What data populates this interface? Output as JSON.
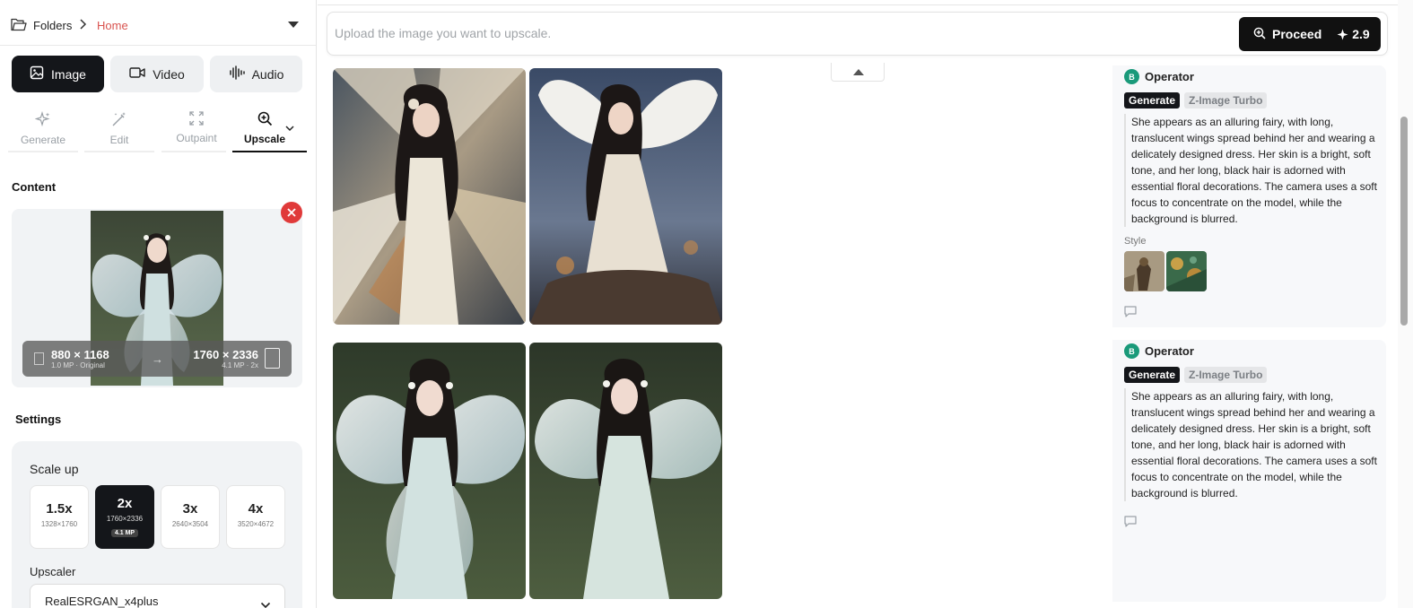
{
  "breadcrumb": {
    "root": "Folders",
    "current": "Home"
  },
  "media_tabs": [
    {
      "label": "Image",
      "icon": "image-icon",
      "active": true
    },
    {
      "label": "Video",
      "icon": "video-icon",
      "active": false
    },
    {
      "label": "Audio",
      "icon": "audio-icon",
      "active": false
    }
  ],
  "tools": [
    {
      "label": "Generate",
      "icon": "sparkle-icon",
      "active": false
    },
    {
      "label": "Edit",
      "icon": "wand-icon",
      "active": false
    },
    {
      "label": "Outpaint",
      "icon": "expand-icon",
      "active": false
    },
    {
      "label": "Upscale",
      "icon": "zoom-in-icon",
      "active": true
    }
  ],
  "content": {
    "title": "Content",
    "original_res": "880 × 1168",
    "original_meta": "1.0 MP · Original",
    "arrow": "→",
    "target_res": "1760 × 2336",
    "target_meta": "4.1 MP · 2x"
  },
  "settings": {
    "title": "Settings",
    "scale_label": "Scale up",
    "scales": [
      {
        "value": "1.5x",
        "dims": "1328×1760",
        "active": false
      },
      {
        "value": "2x",
        "dims": "1760×2336",
        "mp": "4.1 MP",
        "active": true
      },
      {
        "value": "3x",
        "dims": "2640×3504",
        "active": false
      },
      {
        "value": "4x",
        "dims": "3520×4672",
        "active": false
      }
    ],
    "upscaler_label": "Upscaler",
    "upscaler_value": "RealESRGAN_x4plus"
  },
  "prompt": {
    "placeholder": "Upload the image you want to upscale.",
    "button_label": "Proceed",
    "cost": "2.9"
  },
  "results": [
    {
      "author": "Operator",
      "avatar_letter": "B",
      "action_tag": "Generate",
      "model_tag": "Z-Image Turbo",
      "description": "She appears as an alluring fairy, with long, translucent wings spread behind her and wearing a delicately designed dress. Her skin is a bright, soft tone, and her long, black hair is adorned with essential floral decorations. The camera uses a soft focus to concentrate on the model, while the background is blurred.",
      "style_label": "Style",
      "has_style": true
    },
    {
      "author": "Operator",
      "avatar_letter": "B",
      "action_tag": "Generate",
      "model_tag": "Z-Image Turbo",
      "description": "She appears as an alluring fairy, with long, translucent wings spread behind her and wearing a delicately designed dress. Her skin is a bright, soft tone, and her long, black hair is adorned with essential floral decorations. The camera uses a soft focus to concentrate on the model, while the background is blurred.",
      "has_style": false
    }
  ],
  "colors": {
    "accent_dark": "#14161a",
    "breadcrumb_home": "#d9534f",
    "remove_button": "#e03a3a",
    "avatar": "#1a9a7a"
  }
}
